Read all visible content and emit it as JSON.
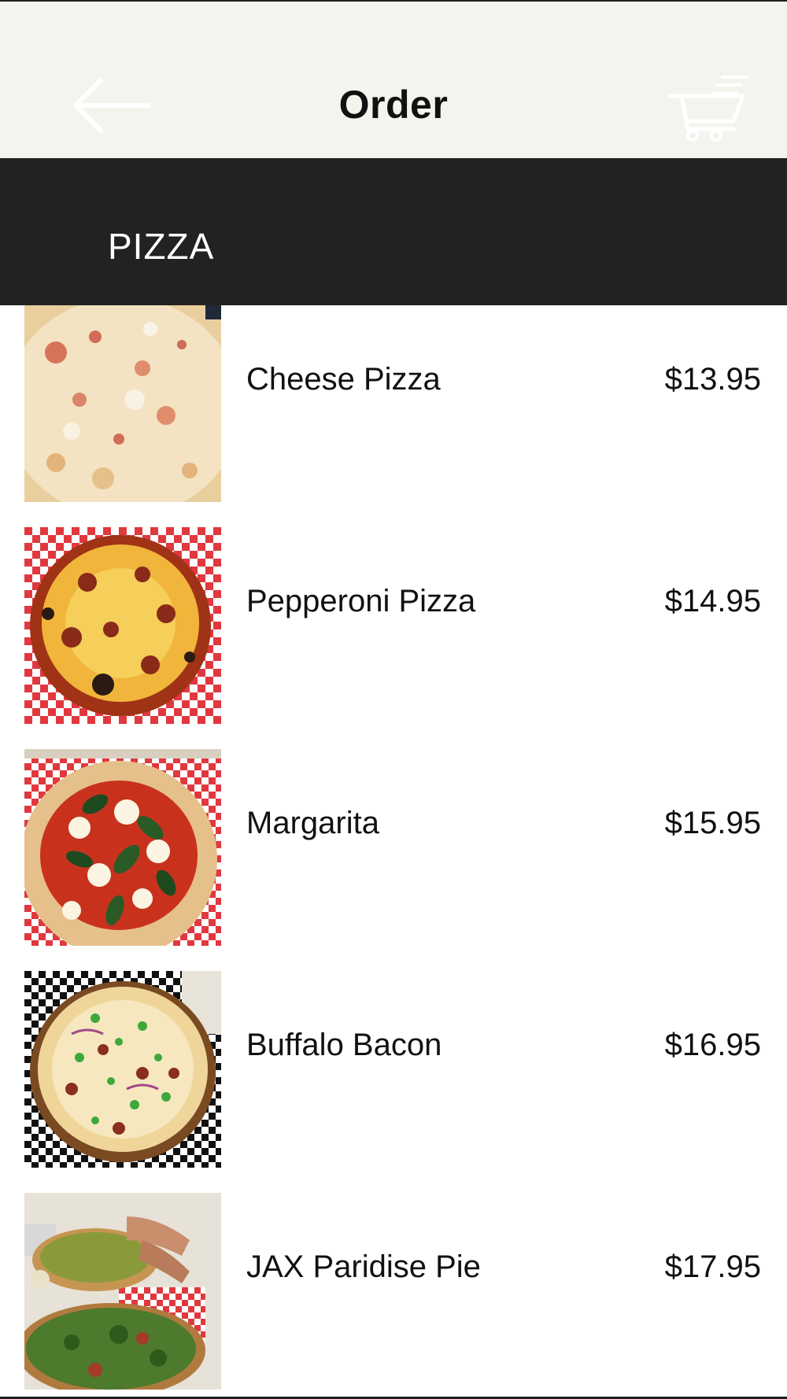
{
  "header": {
    "title": "Order",
    "back_icon": "arrow-left-icon",
    "cart_icon": "shopping-cart-icon"
  },
  "category": {
    "label": "PIZZA"
  },
  "items": [
    {
      "name": "Cheese Pizza",
      "price": "$13.95",
      "image": "cheese-pizza-photo"
    },
    {
      "name": "Pepperoni Pizza",
      "price": "$14.95",
      "image": "pepperoni-pizza-photo"
    },
    {
      "name": "Margarita",
      "price": "$15.95",
      "image": "margarita-pizza-photo"
    },
    {
      "name": "Buffalo Bacon",
      "price": "$16.95",
      "image": "buffalo-bacon-pizza-photo"
    },
    {
      "name": "JAX Paridise Pie",
      "price": "$17.95",
      "image": "jax-paridise-pie-photo"
    }
  ],
  "colors": {
    "header_bg": "#f4f4ef",
    "category_bar_bg": "#222222",
    "text": "#111111"
  }
}
